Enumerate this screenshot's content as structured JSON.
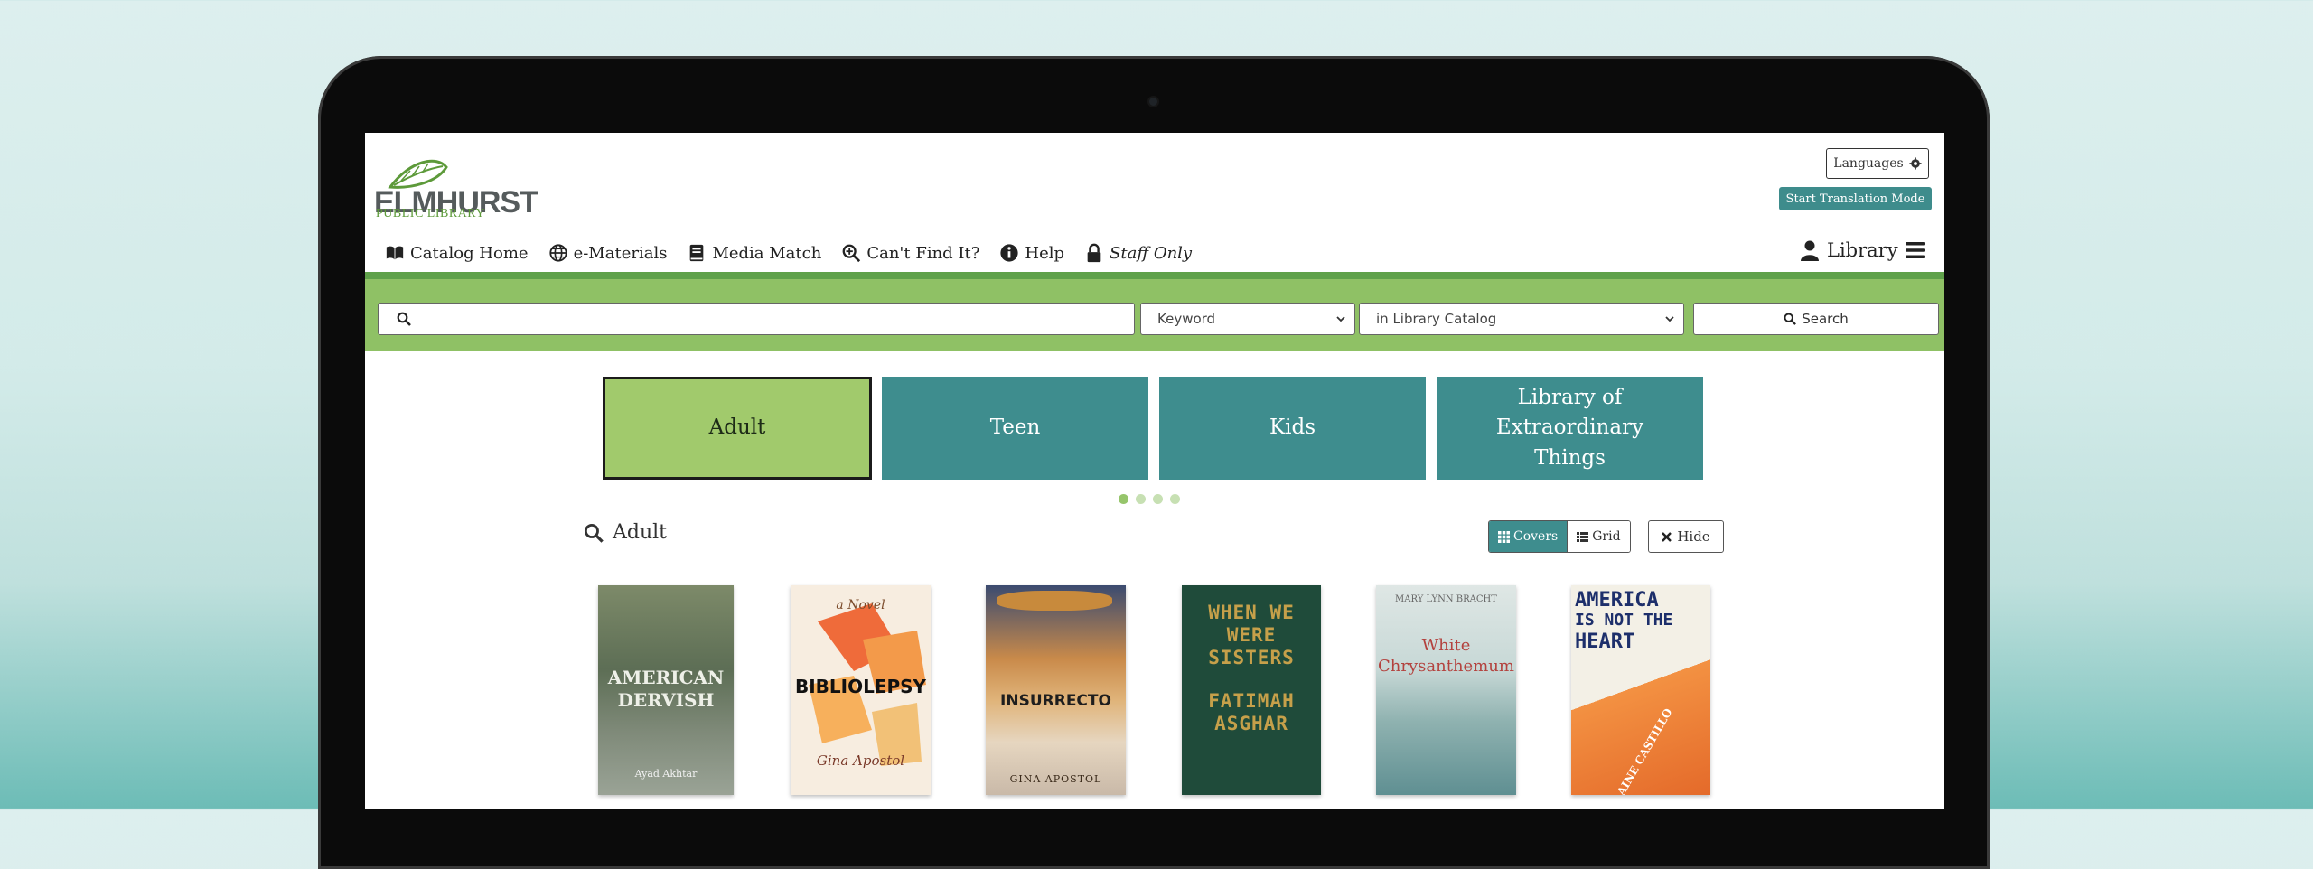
{
  "brand": {
    "name": "ELMHURST",
    "subtitle": "PUBLIC LIBRARY",
    "accent": "#3e8d8e",
    "green": "#8fc165"
  },
  "header": {
    "languages_label": "Languages",
    "translation_label": "Start Translation Mode",
    "account_label": "Library"
  },
  "nav": {
    "items": [
      {
        "label": "Catalog Home",
        "icon": "book-open-icon"
      },
      {
        "label": "e-Materials",
        "icon": "globe-icon"
      },
      {
        "label": "Media Match",
        "icon": "book-icon"
      },
      {
        "label": "Can't Find It?",
        "icon": "search-plus-icon"
      },
      {
        "label": "Help",
        "icon": "info-icon"
      },
      {
        "label": "Staff Only",
        "icon": "lock-icon"
      }
    ]
  },
  "search": {
    "value": "",
    "type_selected": "Keyword",
    "scope_selected": "in Library Catalog",
    "button_label": "Search"
  },
  "audiences": [
    {
      "label": "Adult",
      "selected": true
    },
    {
      "label": "Teen",
      "selected": false
    },
    {
      "label": "Kids",
      "selected": false
    },
    {
      "label": "Library of Extraordinary Things",
      "selected": false
    }
  ],
  "carousel": {
    "page_count": 4,
    "active_index": 0
  },
  "section": {
    "title": "Adult",
    "view_covers_label": "Covers",
    "view_grid_label": "Grid",
    "hide_label": "Hide"
  },
  "books": [
    {
      "title_lines": [
        "AMERICAN",
        "DERVISH"
      ],
      "author": "Ayad Akhtar"
    },
    {
      "title_lines": [
        "BIBLIOLEPSY"
      ],
      "author": "Gina Apostol",
      "kicker": "a Novel"
    },
    {
      "title_lines": [
        "INSURRECTO"
      ],
      "author": "GINA APOSTOL"
    },
    {
      "title_lines": [
        "WHEN WE",
        "WERE",
        "SISTERS",
        "FATIMAH",
        "ASGHAR"
      ],
      "author": ""
    },
    {
      "title_lines": [
        "White",
        "Chrysanthemum"
      ],
      "author": "MARY LYNN BRACHT"
    },
    {
      "title_lines": [
        "AMERICA",
        "IS NOT THE",
        "HEART"
      ],
      "author": "ELAINE CASTILLO"
    }
  ]
}
